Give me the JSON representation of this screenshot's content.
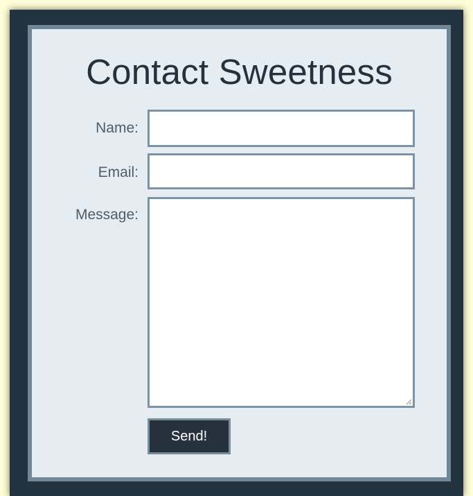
{
  "form": {
    "title": "Contact Sweetness",
    "name_label": "Name:",
    "name_value": "",
    "email_label": "Email:",
    "email_value": "",
    "message_label": "Message:",
    "message_value": "",
    "send_label": "Send!"
  },
  "colors": {
    "page_background": "#fffed6",
    "frame": "#23323f",
    "panel": "#e6edf2",
    "field_border": "#7b93a4",
    "button_background": "#25323e"
  }
}
